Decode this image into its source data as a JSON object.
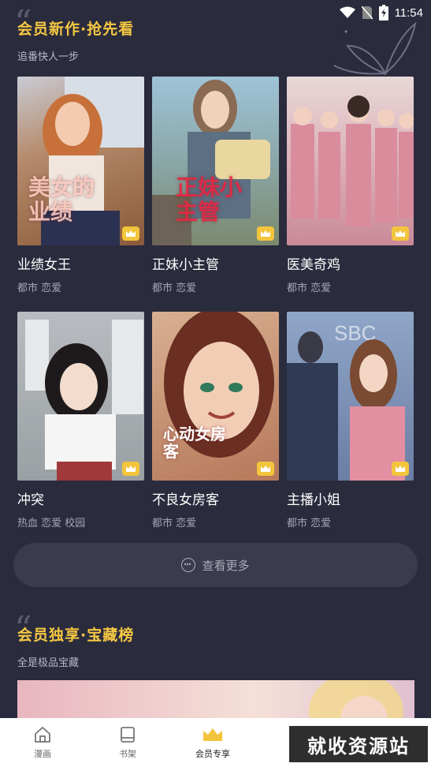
{
  "status_bar": {
    "time": "11:54"
  },
  "section1": {
    "title": "会员新作·抢先看",
    "subtitle": "追番快人一步"
  },
  "comics": [
    {
      "cover_text": "美女的业绩",
      "title": "业绩女王",
      "tags": "都市 恋爱"
    },
    {
      "cover_text": "正妹小主管",
      "title": "正妹小主管",
      "tags": "都市 恋爱"
    },
    {
      "cover_text": "",
      "title": "医美奇鸡",
      "tags": "都市 恋爱"
    },
    {
      "cover_text": "",
      "title": "冲突",
      "tags": "热血 恋爱 校园"
    },
    {
      "cover_text": "心动女房客",
      "title": "不良女房客",
      "tags": "都市 恋爱"
    },
    {
      "cover_text": "SBC",
      "title": "主播小姐",
      "tags": "都市 恋爱"
    }
  ],
  "more_button": {
    "label": "查看更多"
  },
  "section2": {
    "title": "会员独享·宝藏榜",
    "subtitle": "全是极品宝藏"
  },
  "tabbar": {
    "tabs": [
      {
        "label": "漫画",
        "icon": "home-icon"
      },
      {
        "label": "书架",
        "icon": "bookshelf-icon"
      },
      {
        "label": "会员专享",
        "icon": "crown-icon",
        "active": true
      }
    ]
  },
  "watermark": "就收资源站",
  "colors": {
    "background": "#2a2b3d",
    "accent": "#f5c842",
    "badge": "#f3c53c"
  }
}
